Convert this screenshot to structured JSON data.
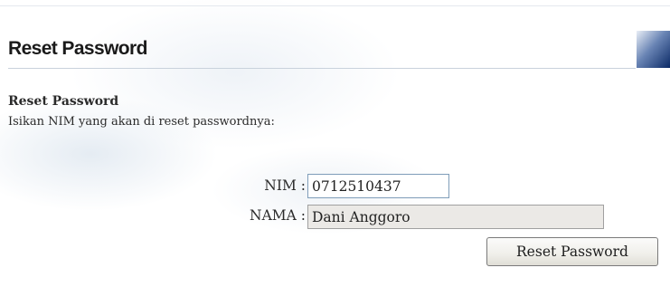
{
  "header": {
    "title": "Reset Password"
  },
  "section": {
    "title": "Reset Password",
    "instruction": "Isikan NIM yang akan di reset passwordnya:"
  },
  "form": {
    "nim_label": "NIM :",
    "nim_value": "0712510437",
    "nama_label": "NAMA :",
    "nama_value": "Dani Anggoro",
    "submit_label": "Reset Password"
  },
  "colors": {
    "readonly_field_bg": "#ebe9e6",
    "input_border": "#7f9db9",
    "header_rule": "#c9d2dc"
  }
}
